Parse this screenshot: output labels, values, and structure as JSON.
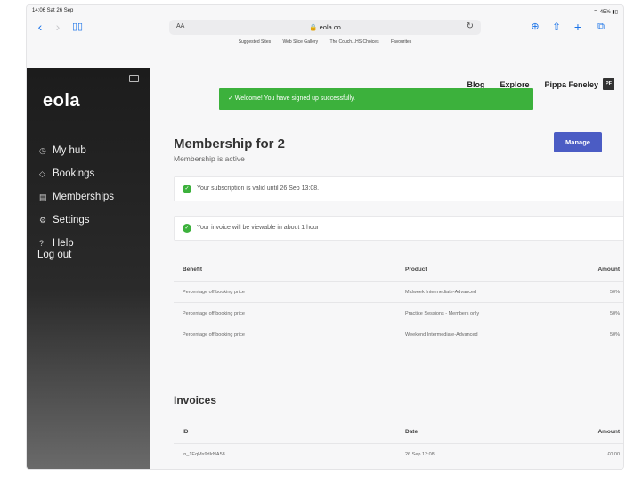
{
  "status": {
    "time": "14:06  Sat 26 Sep",
    "battery": "45%"
  },
  "browser": {
    "text_size": "AA",
    "url": "eola.co",
    "favourites": [
      "Suggested Sites",
      "Web Slice Gallery",
      "The Couch...HS Choices",
      "Favourites"
    ]
  },
  "sidebar": {
    "logo": "eola",
    "items": [
      {
        "icon": "◷",
        "label": "My hub"
      },
      {
        "icon": "◇",
        "label": "Bookings"
      },
      {
        "icon": "▤",
        "label": "Memberships"
      },
      {
        "icon": "⚙",
        "label": "Settings"
      },
      {
        "icon": "?",
        "label": "Help"
      }
    ],
    "logout": "Log out"
  },
  "header": {
    "links": [
      "Blog",
      "Explore"
    ],
    "user_name": "Pippa Feneley",
    "user_initials": "PF",
    "toast": "✓  Welcome! You have signed up successfully."
  },
  "membership": {
    "title": "Membership for 2",
    "status": "Membership is active",
    "manage_label": "Manage",
    "notices": [
      "Your subscription is valid until 26 Sep 13:08.",
      "Your invoice will be viewable in about 1 hour"
    ]
  },
  "benefits": {
    "columns": [
      "Benefit",
      "Product",
      "Amount"
    ],
    "rows": [
      [
        "Percentage off booking price",
        "Midweek Intermediate-Advanced",
        "50%"
      ],
      [
        "Percentage off booking price",
        "Practice Sessions - Members only",
        "50%"
      ],
      [
        "Percentage off booking price",
        "Weekend Intermediate-Advanced",
        "50%"
      ]
    ]
  },
  "invoices": {
    "title": "Invoices",
    "columns": [
      "ID",
      "Date",
      "Amount"
    ],
    "rows": [
      [
        "in_1EqMs9dIrNA58",
        "26 Sep 13:08",
        "£0.00"
      ]
    ]
  },
  "colors": {
    "accent": "#4b5cc4",
    "success": "#3cb13c",
    "browser_blue": "#1a73e8"
  }
}
